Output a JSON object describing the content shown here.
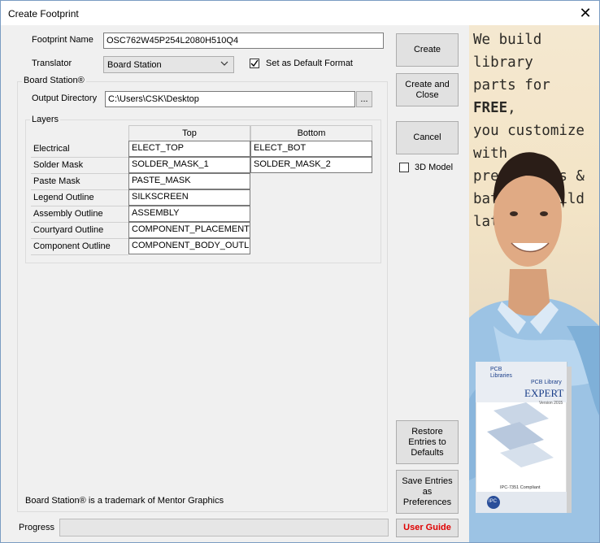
{
  "window": {
    "title": "Create Footprint"
  },
  "form": {
    "footprint_name_label": "Footprint Name",
    "footprint_name_value": "OSC762W45P254L2080H510Q4",
    "translator_label": "Translator",
    "translator_value": "Board Station",
    "default_format_label": "Set as Default Format",
    "default_format_checked": true
  },
  "board_station": {
    "group_title": "Board Station®",
    "output_dir_label": "Output Directory",
    "output_dir_value": "C:\\Users\\CSK\\Desktop",
    "browse_label": "...",
    "layers_title": "Layers",
    "col_top": "Top",
    "col_bottom": "Bottom",
    "rows": [
      {
        "label": "Electrical",
        "top": "ELECT_TOP",
        "bottom": "ELECT_BOT"
      },
      {
        "label": "Solder Mask",
        "top": "SOLDER_MASK_1",
        "bottom": "SOLDER_MASK_2"
      },
      {
        "label": "Paste Mask",
        "top": "PASTE_MASK"
      },
      {
        "label": "Legend Outline",
        "top": "SILKSCREEN"
      },
      {
        "label": "Assembly Outline",
        "top": "ASSEMBLY"
      },
      {
        "label": "Courtyard Outline",
        "top": "COMPONENT_PLACEMENT_"
      },
      {
        "label": "Component Outline",
        "top": "COMPONENT_BODY_OUTLI"
      }
    ],
    "trademark": "Board Station® is a trademark of Mentor Graphics"
  },
  "buttons": {
    "create": "Create",
    "create_close_1": "Create and",
    "create_close_2": "Close",
    "cancel": "Cancel",
    "model_3d": "3D Model",
    "model_3d_checked": false,
    "restore_1": "Restore",
    "restore_2": "Entries to",
    "restore_3": "Defaults",
    "save_1": "Save Entries",
    "save_2": "as",
    "save_3": "Preferences",
    "user_guide": "User Guide"
  },
  "status": {
    "progress_label": "Progress",
    "progress_value": 0
  },
  "ad": {
    "line1": "We build library",
    "line2a": "parts for ",
    "line2b": "FREE",
    "line2c": ",",
    "line3": "you customize",
    "line4": "with preferences &",
    "line5": "batch-rebuild later!",
    "box_brand_1": "PCB",
    "box_brand_2": "Libraries",
    "box_title_1": "PCB Library",
    "box_title_2": "EXPERT",
    "box_version": "Version 2015",
    "box_badge": "IPC-7351 Compliant",
    "box_logo": "IPC"
  },
  "colors": {
    "accent_red": "#e00000",
    "window_bg": "#f0f0f0"
  }
}
